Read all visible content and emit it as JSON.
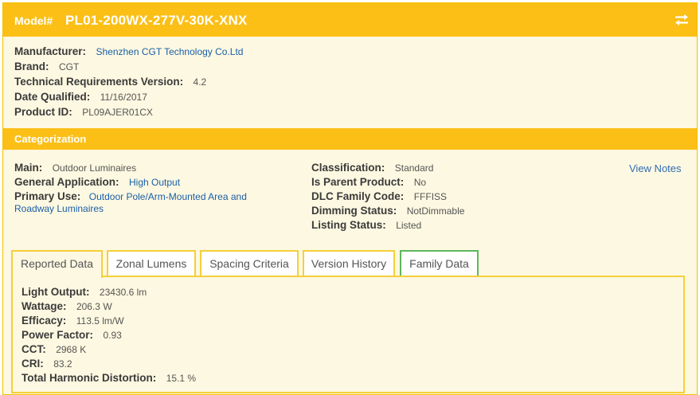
{
  "header": {
    "model_prefix": "Model#",
    "model_value": "PL01-200WX-277V-30K-XNX",
    "swap_icon": "swap-arrows-icon"
  },
  "details": [
    {
      "label": "Manufacturer:",
      "value": "Shenzhen CGT Technology Co.Ltd",
      "is_link": true
    },
    {
      "label": "Brand:",
      "value": "CGT"
    },
    {
      "label": "Technical Requirements Version:",
      "value": "4.2"
    },
    {
      "label": "Date Qualified:",
      "value": "11/16/2017"
    },
    {
      "label": "Product ID:",
      "value": "PL09AJER01CX"
    }
  ],
  "categorization": {
    "title": "Categorization",
    "left": [
      {
        "label": "Main:",
        "value": "Outdoor Luminaires"
      },
      {
        "label": "General Application:",
        "value": "High Output",
        "is_link": true
      },
      {
        "label": "Primary Use:",
        "value_line1": "Outdoor Pole/Arm-Mounted Area and",
        "value_line2": "Roadway Luminaires",
        "is_link": true
      }
    ],
    "right": [
      {
        "label": "Classification:",
        "value": "Standard"
      },
      {
        "label": "Is Parent Product:",
        "value": "No"
      },
      {
        "label": "DLC Family Code:",
        "value": "FFFISS"
      },
      {
        "label": "Dimming Status:",
        "value": "NotDimmable"
      },
      {
        "label": "Listing Status:",
        "value": "Listed"
      }
    ],
    "view_notes": "View Notes"
  },
  "tabs": [
    {
      "label": "Reported Data",
      "active": true
    },
    {
      "label": "Zonal Lumens"
    },
    {
      "label": "Spacing Criteria"
    },
    {
      "label": "Version History"
    },
    {
      "label": "Family Data"
    }
  ],
  "reported_data": [
    {
      "label": "Light Output:",
      "value": "23430.6 lm"
    },
    {
      "label": "Wattage:",
      "value": "206.3 W"
    },
    {
      "label": "Efficacy:",
      "value": "113.5 lm/W"
    },
    {
      "label": "Power Factor:",
      "value": "0.93"
    },
    {
      "label": "CCT:",
      "value": "2968 K"
    },
    {
      "label": "CRI:",
      "value": "83.2"
    },
    {
      "label": "Total Harmonic Distortion:",
      "value": "15.1 %"
    }
  ],
  "colors": {
    "accent": "#fbbf16",
    "card_bg": "#fdf8e1",
    "link": "#1a5fa8",
    "tab_green": "#5cb85c"
  }
}
